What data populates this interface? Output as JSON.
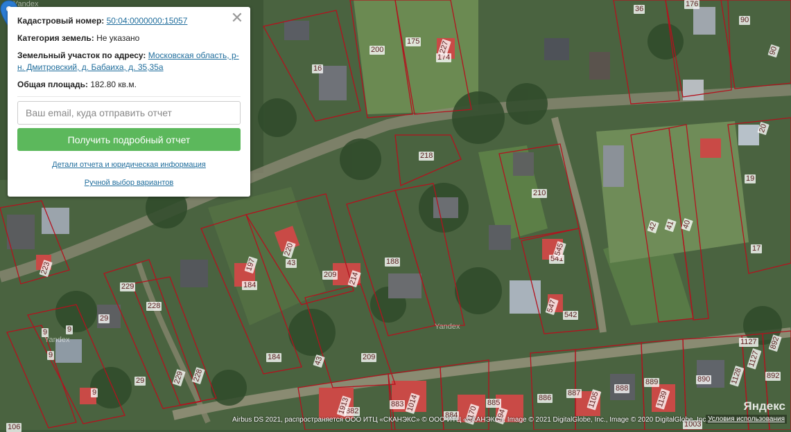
{
  "popup": {
    "cadastral_label": "Кадастровый номер:",
    "cadastral_value": "50:04:0000000:15057",
    "category_label": "Категория земель:",
    "category_value": "Не указано",
    "address_label": "Земельный участок по адресу:",
    "address_value": "Московская область, р-н. Дмитровский, д. Бабаиха, д. 35,35а",
    "area_label": "Общая площадь:",
    "area_value": "182.80 кв.м.",
    "email_placeholder": "Ваш email, куда отправить отчет",
    "report_button": "Получить подробный отчет",
    "details_link": "Детали отчета и юридическая информация",
    "manual_link": "Ручной выбор вариантов",
    "close_glyph": "✕"
  },
  "map": {
    "parcel_labels": [
      "36",
      "176",
      "90",
      "200",
      "175",
      "174",
      "227",
      "16",
      "90",
      "20",
      "218",
      "210",
      "19",
      "42",
      "41",
      "40",
      "17",
      "220",
      "43",
      "197",
      "184",
      "209",
      "214",
      "188",
      "541",
      "545",
      "547",
      "542",
      "223",
      "229",
      "228",
      "29",
      "9",
      "9",
      "9",
      "29",
      "229",
      "228",
      "184",
      "43",
      "209",
      "1127",
      "892",
      "1127",
      "892",
      "888",
      "889",
      "890",
      "1128",
      "1139",
      "886",
      "887",
      "1105",
      "882",
      "883",
      "884",
      "885",
      "1170",
      "1003",
      "194",
      "1913",
      "1014",
      "106",
      "9"
    ],
    "watermarks": [
      "Yandex",
      "Yandex",
      "Yandex"
    ]
  },
  "footer": {
    "attribution": "Airbus DS 2021, распространяется ООО ИТЦ «СКАНЭКС» © ООО ИТЦ «СКАНЭКС», Image © 2021 DigitalGlobe, Inc., Image © 2020 DigitalGlobe, Inc.",
    "terms": "Условия использования",
    "logo": "Яндекс"
  },
  "colors": {
    "parcel_border": "#b3121e",
    "button_green": "#5cb85c",
    "link": "#1f6d9c",
    "marker": "#2b7cd3"
  }
}
